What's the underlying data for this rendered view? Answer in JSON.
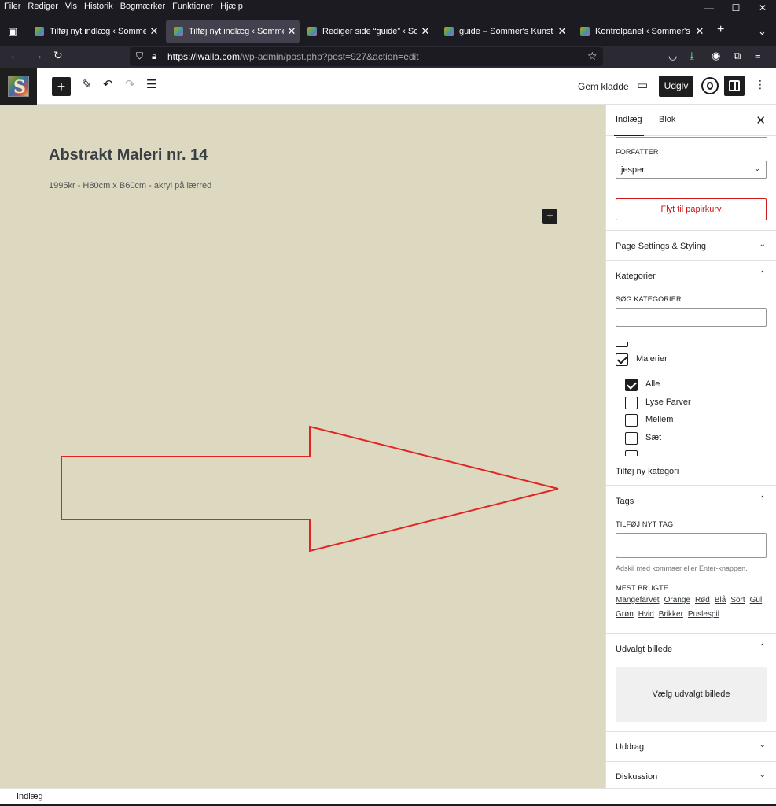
{
  "browser": {
    "menu": [
      "Filer",
      "Rediger",
      "Vis",
      "Historik",
      "Bogmærker",
      "Funktioner",
      "Hjælp"
    ],
    "tabs": [
      {
        "title": "Tilføj nyt indlæg ‹ Sommer's Ku",
        "active": false
      },
      {
        "title": "Tilføj nyt indlæg ‹ Sommer's Ku",
        "active": true
      },
      {
        "title": "Rediger side “guide” ‹ Sommer",
        "active": false
      },
      {
        "title": "guide – Sommer's Kunst",
        "active": false
      },
      {
        "title": "Kontrolpanel ‹ Sommer's Kunst",
        "active": false
      }
    ],
    "url_domain": "https://iwalla.com",
    "url_path": "/wp-admin/post.php?post=927&action=edit"
  },
  "editor": {
    "header": {
      "logo_letter": "S",
      "save_draft": "Gem kladde",
      "publish": "Udgiv"
    },
    "post": {
      "title": "Abstrakt Maleri nr. 14",
      "subtitle": "1995kr - H80cm x B60cm - akryl på lærred"
    },
    "sidebar": {
      "tab_post": "Indlæg",
      "tab_block": "Blok",
      "author_label": "FORFATTER",
      "author_value": "jesper",
      "trash_button": "Flyt til papirkurv",
      "page_settings": "Page Settings & Styling",
      "categories": {
        "title": "Kategorier",
        "search_label": "SØG KATEGORIER",
        "items": [
          {
            "label": "Malerier",
            "checked": true
          },
          {
            "label": "Alle",
            "checked": true
          },
          {
            "label": "Lyse Farver",
            "checked": false
          },
          {
            "label": "Mellem",
            "checked": false
          },
          {
            "label": "Sæt",
            "checked": false
          }
        ],
        "add_new": "Tilføj ny kategori"
      },
      "tags": {
        "title": "Tags",
        "add_label": "TILFØJ NYT TAG",
        "hint": "Adskil med kommaer eller Enter-knappen.",
        "most_used_label": "MEST BRUGTE",
        "most_used": [
          "Mangefarvet",
          "Orange",
          "Rød",
          "Blå",
          "Sort",
          "Gul",
          "Grøn",
          "Hvid",
          "Brikker",
          "Puslespil"
        ]
      },
      "featured_image": {
        "title": "Udvalgt billede",
        "button": "Vælg udvalgt billede"
      },
      "excerpt": "Uddrag",
      "discussion": "Diskussion"
    },
    "status_bar": "Indlæg"
  },
  "colors": {
    "canvas_bg": "#ddd8c0",
    "annotation_arrow": "#e02424",
    "danger": "#cc1818"
  }
}
